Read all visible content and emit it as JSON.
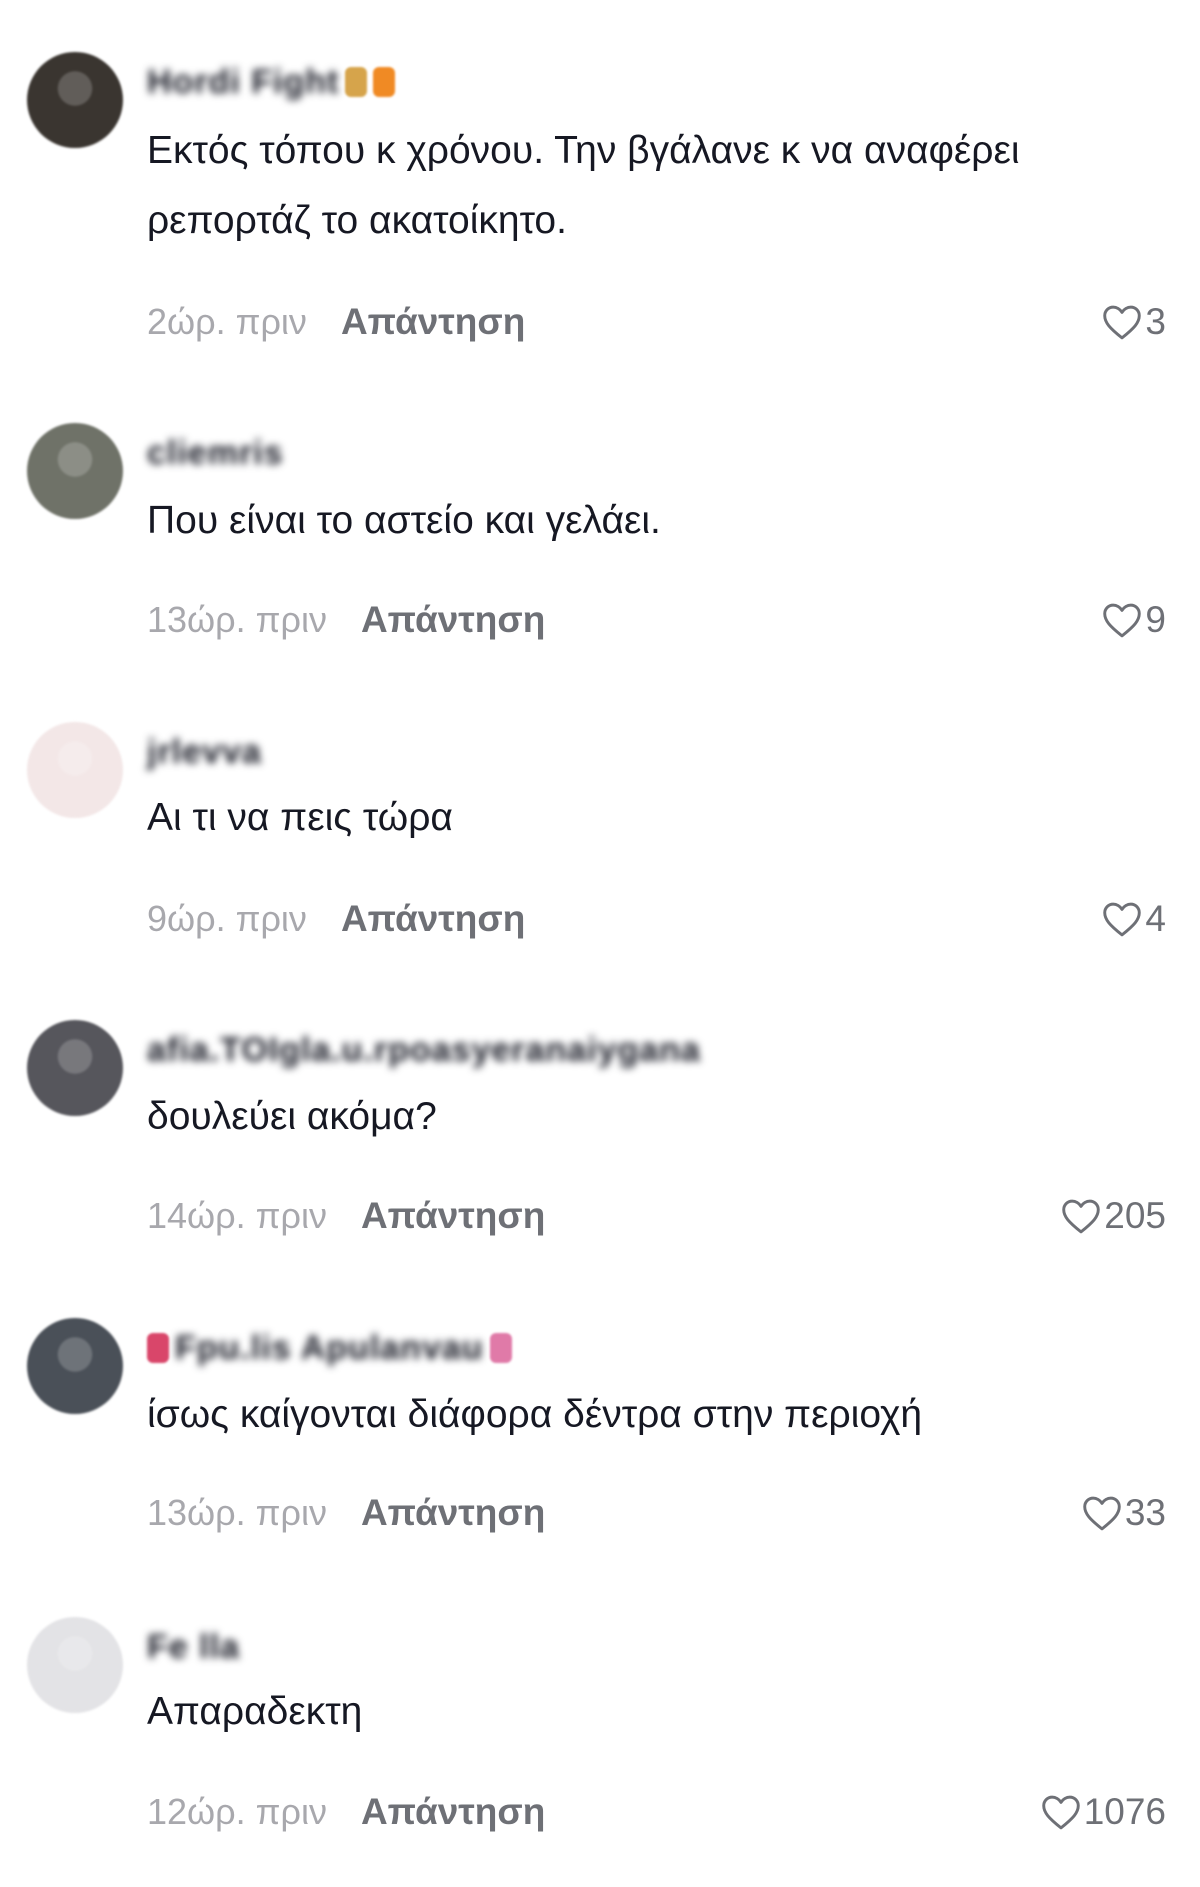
{
  "comments": [
    {
      "username": "Hordi Fight",
      "text": "Εκτός τόπου κ χρόνου. Την βγάλανε κ να αναφέρει ρεπορτάζ το ακατοίκητο.",
      "time": "2ώρ. πριν",
      "reply_label": "Απάντηση",
      "likes": "3",
      "avatar_color": "#3a3530",
      "emoji_colors": [
        "#d6a44b",
        "#f08a24"
      ]
    },
    {
      "username": "cliemris",
      "text": "Που είναι το αστείο και γελάει.",
      "time": "13ώρ. πριν",
      "reply_label": "Απάντηση",
      "likes": "9",
      "avatar_color": "#6f7268",
      "emoji_colors": []
    },
    {
      "username": "jrlevva",
      "text": "Αι τι να πεις τώρα",
      "time": "9ώρ. πριν",
      "reply_label": "Απάντηση",
      "likes": "4",
      "avatar_color": "#f3e7e7",
      "emoji_colors": []
    },
    {
      "username": "afia.TOIgla.u.rpoasyeranaiygana",
      "text": "δουλεύει ακόμα?",
      "time": "14ώρ. πριν",
      "reply_label": "Απάντηση",
      "likes": "205",
      "avatar_color": "#56565c",
      "emoji_colors": []
    },
    {
      "username": "Fpu.lis Apulanvau",
      "text": "ίσως καίγονται διάφορα δέντρα στην περιοχή",
      "time": "13ώρ. πριν",
      "reply_label": "Απάντηση",
      "likes": "33",
      "avatar_color": "#4a5058",
      "emoji_colors": [
        "#d9466a",
        "#e07aa8"
      ]
    },
    {
      "username": "Fe lla",
      "text": "Απαραδεκτη",
      "time": "12ώρ. πριν",
      "reply_label": "Απάντηση",
      "likes": "1076",
      "avatar_color": "#e3e3e6",
      "emoji_colors": []
    }
  ],
  "icons": {
    "like": "heart-outline-icon"
  }
}
